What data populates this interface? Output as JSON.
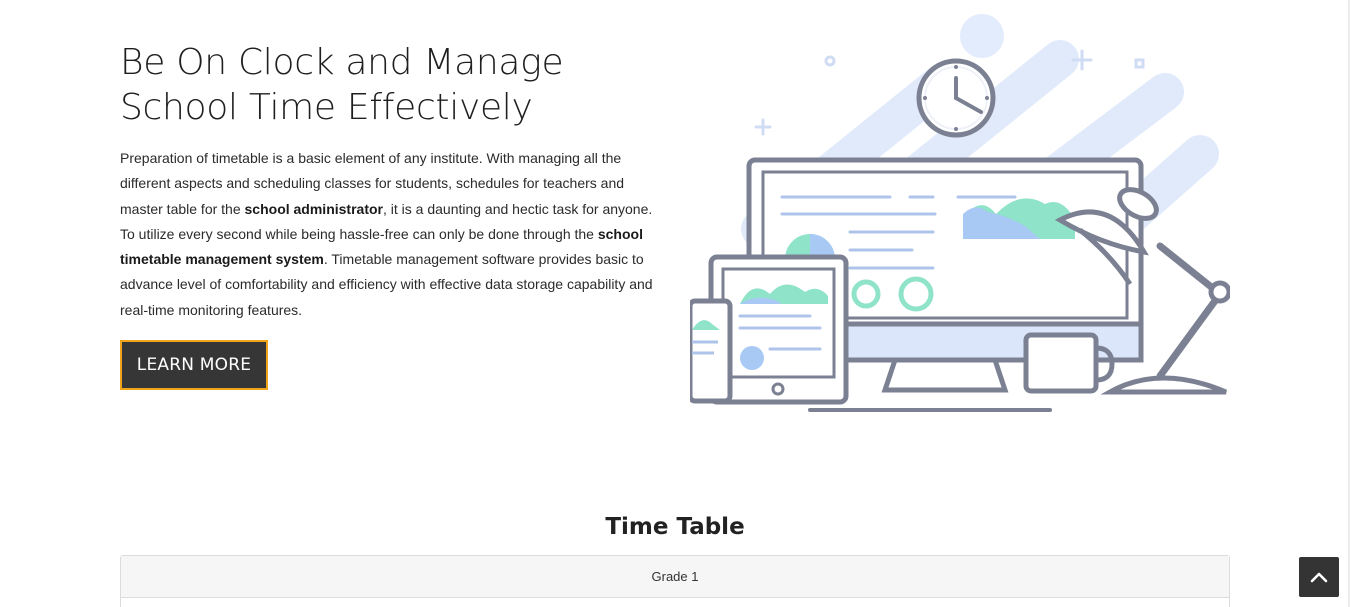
{
  "hero": {
    "title_line1": "Be On Clock and Manage",
    "title_line2": "School Time Effectively",
    "body_part1": "Preparation of timetable is a basic element of any institute. With managing all the different aspects and scheduling classes for students, schedules for teachers and master table for the ",
    "body_bold1": "school administrator",
    "body_part2": ", it is a daunting and hectic task for anyone. To utilize every second while being hassle-free can only be done through the ",
    "body_bold2": "school timetable management system",
    "body_part3": ". Timetable management software provides basic to advance level of comfortability and efficiency with effective data storage capability and real-time monitoring features.",
    "cta_label": "LEARN MORE"
  },
  "illustration": {
    "icon": "clock-and-devices-illustration",
    "colors": {
      "outline": "#7b8192",
      "blue": "#d6e4fb",
      "green": "#8ee3c8",
      "dark_blue": "#a9c9f5"
    }
  },
  "timetable": {
    "title": "Time Table",
    "header": "Grade 1"
  },
  "scroll_top": {
    "icon": "chevron-up-icon"
  },
  "colors": {
    "button_bg": "#363636",
    "button_border": "#f0a419",
    "scroll_button_bg": "#343434"
  }
}
